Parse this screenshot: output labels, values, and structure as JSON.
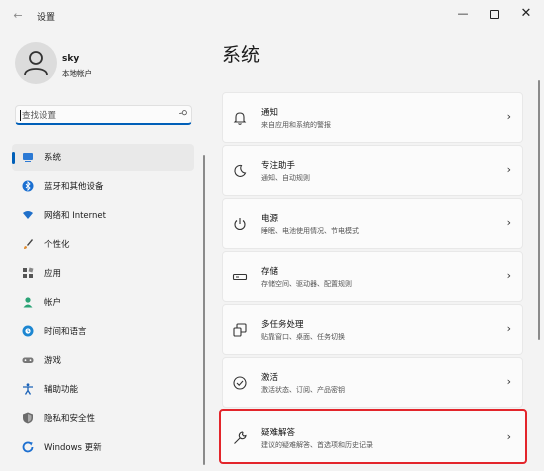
{
  "window": {
    "title": "设置"
  },
  "profile": {
    "name": "sky",
    "account_type": "本地帐户"
  },
  "search": {
    "placeholder": "查找设置"
  },
  "nav": [
    {
      "label": "系统",
      "icon": "monitor-icon",
      "active": true
    },
    {
      "label": "蓝牙和其他设备",
      "icon": "bluetooth-icon"
    },
    {
      "label": "网络和 Internet",
      "icon": "wifi-icon"
    },
    {
      "label": "个性化",
      "icon": "brush-icon"
    },
    {
      "label": "应用",
      "icon": "apps-icon"
    },
    {
      "label": "帐户",
      "icon": "person-icon"
    },
    {
      "label": "时间和语言",
      "icon": "globe-clock-icon"
    },
    {
      "label": "游戏",
      "icon": "gamepad-icon"
    },
    {
      "label": "辅助功能",
      "icon": "accessibility-icon"
    },
    {
      "label": "隐私和安全性",
      "icon": "shield-icon"
    },
    {
      "label": "Windows 更新",
      "icon": "update-icon"
    }
  ],
  "page": {
    "title": "系统"
  },
  "cards": [
    {
      "title": "通知",
      "subtitle": "来自应用和系统的警报",
      "icon": "bell-icon"
    },
    {
      "title": "专注助手",
      "subtitle": "通知、自动规则",
      "icon": "moon-icon"
    },
    {
      "title": "电源",
      "subtitle": "睡眠、电池使用情况、节电模式",
      "icon": "power-icon"
    },
    {
      "title": "存储",
      "subtitle": "存储空间、驱动器、配置规则",
      "icon": "storage-icon"
    },
    {
      "title": "多任务处理",
      "subtitle": "贴靠窗口、桌面、任务切换",
      "icon": "multitask-icon"
    },
    {
      "title": "激活",
      "subtitle": "激活状态、订阅、产品密钥",
      "icon": "check-circle-icon"
    },
    {
      "title": "疑难解答",
      "subtitle": "建议的疑难解答、首选项和历史记录",
      "icon": "wrench-icon",
      "highlighted": true
    }
  ],
  "colors": {
    "accent": "#005fb8",
    "highlight_border": "#e3252b",
    "background": "#f3f3f3",
    "card": "#fbfbfb"
  }
}
